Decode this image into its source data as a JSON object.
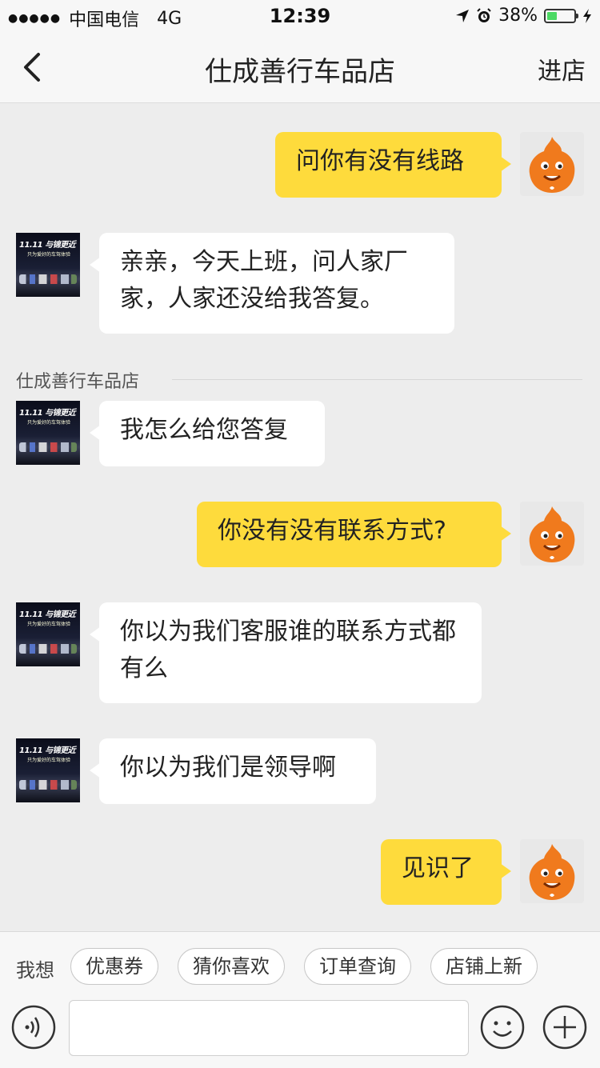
{
  "status_bar": {
    "carrier": "中国电信",
    "network": "4G",
    "time": "12:39",
    "battery": "38%",
    "battery_fraction": 0.38
  },
  "navbar": {
    "title": "仕成善行车品店",
    "enter_label": "进店"
  },
  "shop_avatar_text": {
    "logo": "11.11 与锦更近",
    "sub": "只为爱好的车驾体验"
  },
  "messages": [
    {
      "side": "right",
      "text": "问你有没有线路"
    },
    {
      "side": "left",
      "text": "亲亲，今天上班，问人家厂家，人家还没给我答复。"
    },
    {
      "side": "left",
      "text": "我怎么给您答复"
    },
    {
      "side": "right",
      "text": "你没有没有联系方式?"
    },
    {
      "side": "left",
      "text": "你以为我们客服谁的联系方式都有么"
    },
    {
      "side": "left",
      "text": "你以为我们是领导啊"
    },
    {
      "side": "right",
      "text": "见识了"
    }
  ],
  "shop_label": "仕成善行车品店",
  "quick_bar": {
    "label": "我想",
    "chips": [
      "优惠券",
      "猜你喜欢",
      "订单查询",
      "店铺上新"
    ]
  },
  "input": {
    "placeholder": ""
  },
  "icons": {
    "back": "chevron-left-icon",
    "voice": "voice-icon",
    "emoji": "smiley-icon",
    "plus": "plus-icon",
    "location": "location-arrow-icon",
    "alarm": "alarm-icon",
    "charging": "bolt-icon"
  },
  "colors": {
    "my_bubble": "#fedb3c",
    "their_bubble": "#ffffff",
    "background": "#ededed",
    "avatar_orange": "#f07a1d"
  }
}
